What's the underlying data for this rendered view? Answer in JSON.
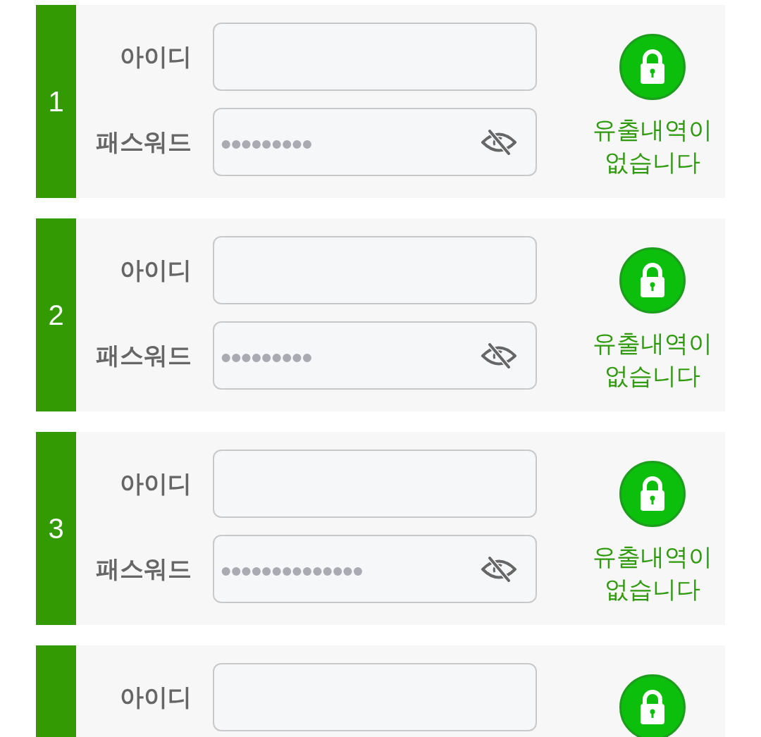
{
  "cards": [
    {
      "number": "1",
      "fields": [
        {
          "kind": "id",
          "label": "아이디"
        },
        {
          "kind": "password",
          "label": "패스워드",
          "value": "•••••••••"
        }
      ],
      "status": "유출내역이 없습니다"
    },
    {
      "number": "2",
      "fields": [
        {
          "kind": "id",
          "label": "아이디"
        },
        {
          "kind": "password",
          "label": "패스워드",
          "value": "•••••••••"
        }
      ],
      "status": "유출내역이 없습니다"
    },
    {
      "number": "3",
      "fields": [
        {
          "kind": "id",
          "label": "아이디"
        },
        {
          "kind": "password",
          "label": "패스워드",
          "value": "••••••••••••••"
        }
      ],
      "status": "유출내역이 없습니다"
    },
    {
      "fields": [
        {
          "kind": "id",
          "label": "아이디"
        }
      ]
    }
  ]
}
